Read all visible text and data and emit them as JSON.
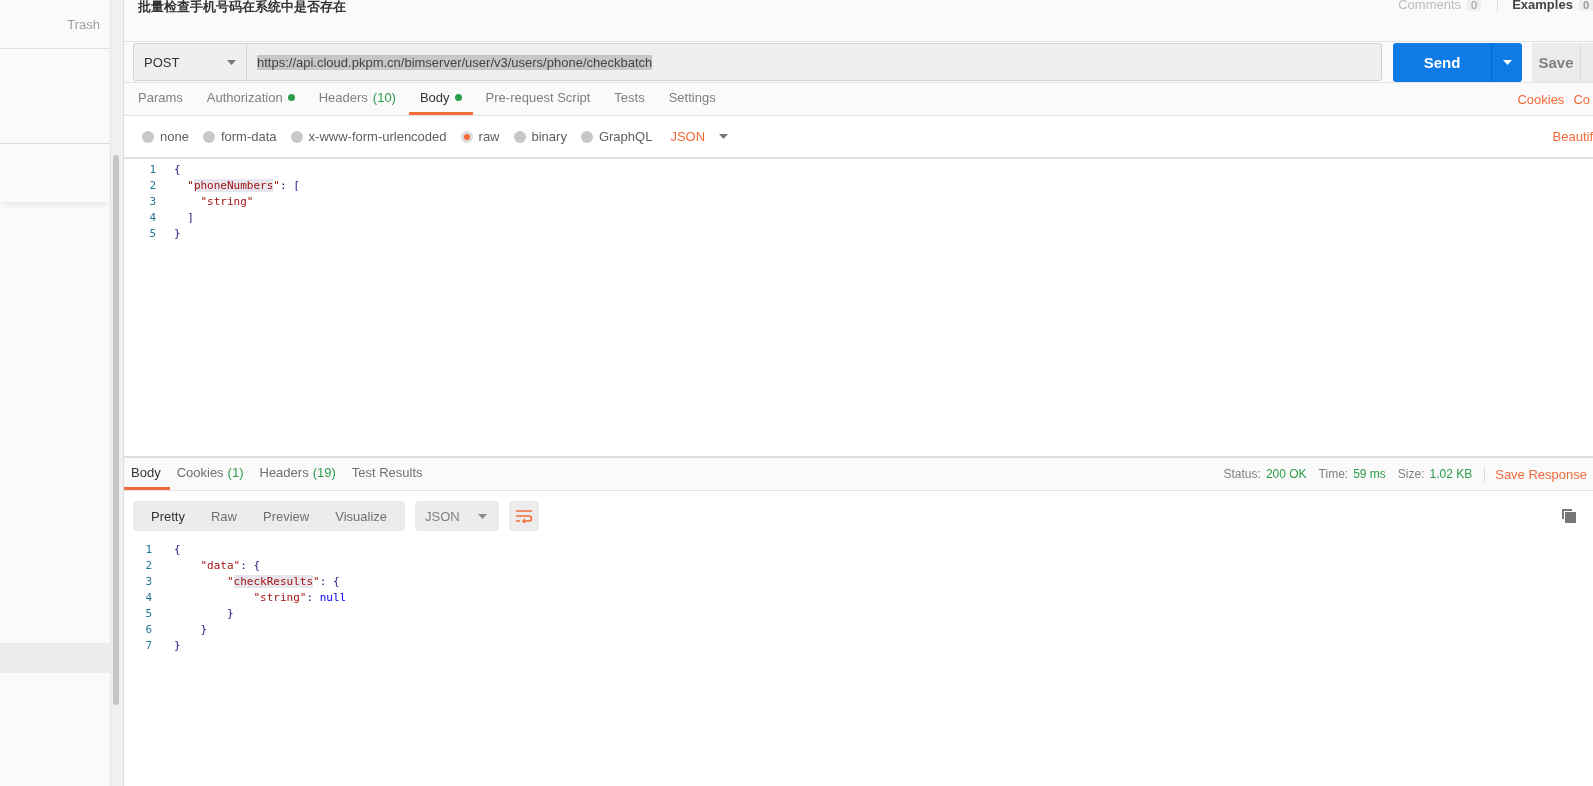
{
  "sidebar": {
    "trash_label": "Trash"
  },
  "request": {
    "title": "批量检查手机号码在系统中是否存在",
    "comments": {
      "label": "Comments",
      "count": "0"
    },
    "examples": {
      "label": "Examples",
      "count": "0"
    },
    "method": "POST",
    "url": "https://api.cloud.pkpm.cn/bimserver/user/v3/users/phone/checkbatch",
    "send_label": "Send",
    "save_label": "Save",
    "tabs": [
      {
        "label": "Params",
        "selected": false
      },
      {
        "label": "Authorization",
        "selected": false,
        "dot": true
      },
      {
        "label": "Headers",
        "count": "(10)",
        "selected": false
      },
      {
        "label": "Body",
        "selected": true,
        "dot": true
      },
      {
        "label": "Pre-request Script",
        "selected": false
      },
      {
        "label": "Tests",
        "selected": false
      },
      {
        "label": "Settings",
        "selected": false
      }
    ],
    "links": [
      "Cookies",
      "Co"
    ],
    "body_types": [
      {
        "label": "none",
        "selected": false
      },
      {
        "label": "form-data",
        "selected": false
      },
      {
        "label": "x-www-form-urlencoded",
        "selected": false
      },
      {
        "label": "raw",
        "selected": true
      },
      {
        "label": "binary",
        "selected": false
      },
      {
        "label": "GraphQL",
        "selected": false
      }
    ],
    "format": "JSON",
    "beautify": "Beautif",
    "body_lines": [
      {
        "number": "1",
        "tokens": [
          {
            "kind": "punct",
            "text": "{"
          }
        ]
      },
      {
        "number": "2",
        "tokens": [
          {
            "kind": "string",
            "text": "  \""
          },
          {
            "kind": "match",
            "text": "phoneNumbers"
          },
          {
            "kind": "string",
            "text": "\""
          },
          {
            "kind": "punct",
            "text": ": ["
          }
        ]
      },
      {
        "number": "3",
        "tokens": [
          {
            "kind": "string",
            "text": "    \"string\""
          }
        ]
      },
      {
        "number": "4",
        "tokens": [
          {
            "kind": "punct",
            "text": "  ]"
          }
        ]
      },
      {
        "number": "5",
        "tokens": [
          {
            "kind": "punct",
            "text": "}"
          }
        ]
      }
    ]
  },
  "response": {
    "tabs": [
      {
        "label": "Body",
        "selected": true
      },
      {
        "label": "Cookies",
        "count": "(1)",
        "selected": false
      },
      {
        "label": "Headers",
        "count": "(19)",
        "selected": false
      },
      {
        "label": "Test Results",
        "selected": false
      }
    ],
    "status": {
      "label": "Status:",
      "value": "200 OK"
    },
    "time": {
      "label": "Time:",
      "value": "59 ms"
    },
    "size": {
      "label": "Size:",
      "value": "1.02 KB"
    },
    "save_label": "Save Response",
    "views": [
      {
        "label": "Pretty",
        "selected": true
      },
      {
        "label": "Raw",
        "selected": false
      },
      {
        "label": "Preview",
        "selected": false
      },
      {
        "label": "Visualize",
        "selected": false
      }
    ],
    "format": "JSON",
    "body_lines": [
      {
        "number": "1",
        "tokens": [
          {
            "kind": "punct",
            "text": "{"
          }
        ]
      },
      {
        "number": "2",
        "tokens": [
          {
            "kind": "string",
            "text": "    \"data\""
          },
          {
            "kind": "punct",
            "text": ": {"
          }
        ]
      },
      {
        "number": "3",
        "tokens": [
          {
            "kind": "string",
            "text": "        \""
          },
          {
            "kind": "match",
            "text": "checkResults"
          },
          {
            "kind": "string",
            "text": "\""
          },
          {
            "kind": "punct",
            "text": ": {"
          }
        ]
      },
      {
        "number": "4",
        "tokens": [
          {
            "kind": "string",
            "text": "            \"string\""
          },
          {
            "kind": "punct",
            "text": ": "
          },
          {
            "kind": "null",
            "text": "null"
          }
        ]
      },
      {
        "number": "5",
        "tokens": [
          {
            "kind": "punct",
            "text": "        }"
          }
        ]
      },
      {
        "number": "6",
        "tokens": [
          {
            "kind": "punct",
            "text": "    }"
          }
        ]
      },
      {
        "number": "7",
        "tokens": [
          {
            "kind": "punct",
            "text": "}"
          }
        ]
      }
    ]
  }
}
